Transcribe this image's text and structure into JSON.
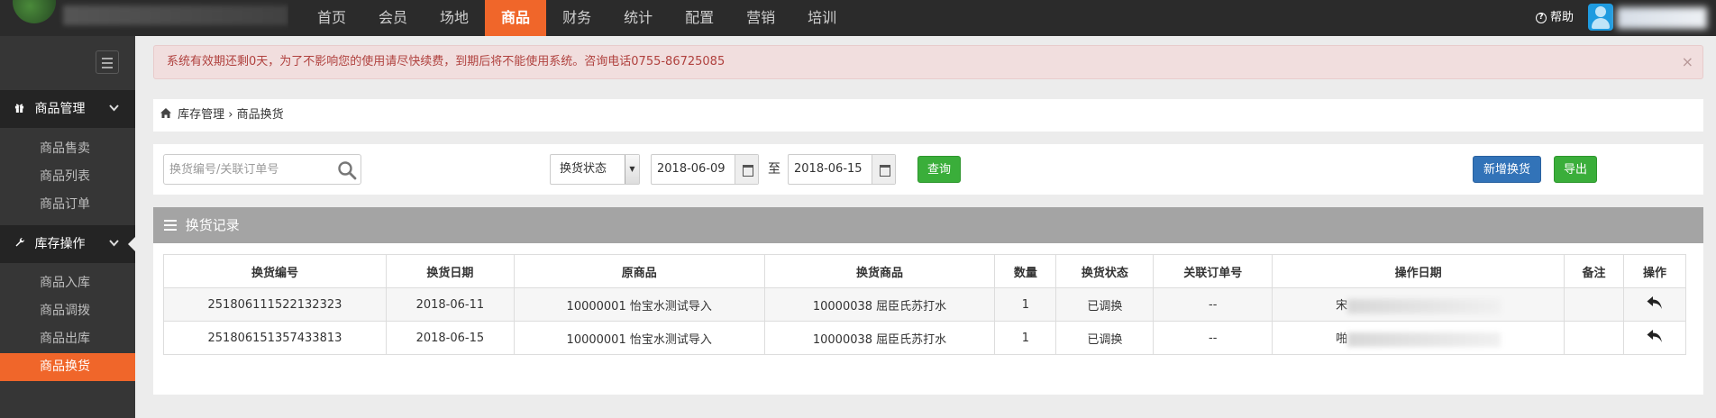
{
  "nav": {
    "items": [
      "首页",
      "会员",
      "场地",
      "商品",
      "财务",
      "统计",
      "配置",
      "营销",
      "培训"
    ],
    "active_index": 3,
    "help_label": "帮助"
  },
  "sidebar": {
    "groups": [
      {
        "label": "商品管理",
        "icon": "gift-icon",
        "items": [
          "商品售卖",
          "商品列表",
          "商品订单"
        ]
      },
      {
        "label": "库存操作",
        "icon": "wrench-icon",
        "items": [
          "商品入库",
          "商品调拨",
          "商品出库",
          "商品换货"
        ]
      }
    ],
    "active_item": "商品换货"
  },
  "alert": {
    "text": "系统有效期还剩0天，为了不影响您的使用请尽快续费，到期后将不能使用系统。咨询电话0755-86725085",
    "close": "×"
  },
  "breadcrumb": {
    "root": "库存管理",
    "separator": "›",
    "current": "商品换货"
  },
  "filters": {
    "search_placeholder": "换货编号/关联订单号",
    "status_select": "换货状态",
    "date_from": "2018-06-09",
    "to_label": "至",
    "date_to": "2018-06-15",
    "query_button": "查询",
    "add_button": "新增换货",
    "export_button": "导出"
  },
  "panel": {
    "title": "换货记录",
    "columns": [
      "换货编号",
      "换货日期",
      "原商品",
      "换货商品",
      "数量",
      "换货状态",
      "关联订单号",
      "操作日期",
      "备注",
      "操作"
    ],
    "rows": [
      {
        "id": "251806111522132323",
        "date": "2018-06-11",
        "original": "10000001 怡宝水测试导入",
        "exchange": "10000038 屈臣氏苏打水",
        "qty": "1",
        "status": "已调换",
        "order": "--",
        "operator_prefix": "宋",
        "note": ""
      },
      {
        "id": "251806151357433813",
        "date": "2018-06-15",
        "original": "10000001 怡宝水测试导入",
        "exchange": "10000038 屈臣氏苏打水",
        "qty": "1",
        "status": "已调换",
        "order": "--",
        "operator_prefix": "啪",
        "note": ""
      }
    ]
  },
  "colors": {
    "accent": "#f0662a",
    "topbar": "#2b2b2b",
    "sidebar": "#363636",
    "alert_bg": "#f1dede",
    "alert_text": "#b0413e",
    "green": "#3aae3a",
    "blue": "#3273b8",
    "panel_head": "#a4a4a4"
  }
}
